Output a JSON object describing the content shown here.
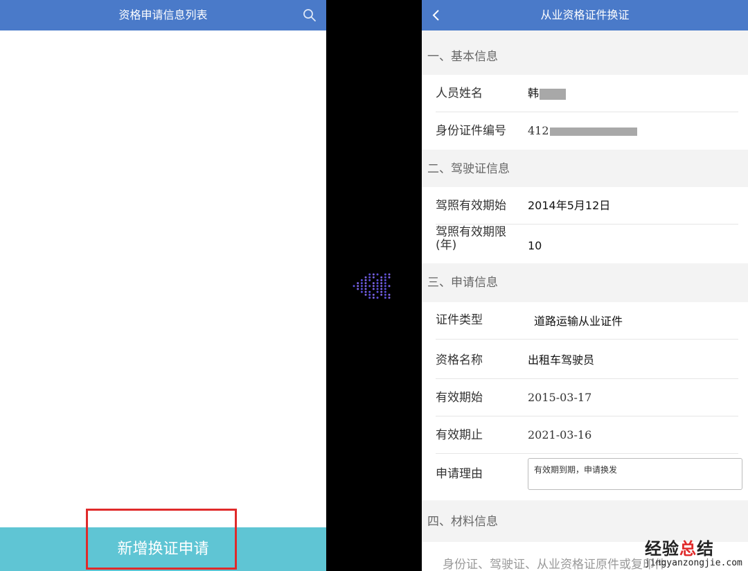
{
  "left_screen": {
    "title": "资格申请信息列表",
    "search_icon": "search-icon",
    "add_button_label": "新增换证申请",
    "header_color": "#4a7ac9",
    "button_color": "#5fc5d4",
    "highlight_color": "#e02a2a"
  },
  "transition_icon": "double-chevron-right-icon",
  "right_screen": {
    "title": "从业资格证件换证",
    "back_icon": "chevron-left-icon",
    "sections": {
      "basic": {
        "header": "一、基本信息",
        "name_label": "人员姓名",
        "name_value": "韩",
        "id_label": "身份证件编号",
        "id_value": "412"
      },
      "license": {
        "header": "二、驾驶证信息",
        "start_label": "驾照有效期始",
        "start_value": "2014年5月12日",
        "limit_label": "驾照有效期限(年)",
        "limit_value": "10"
      },
      "application": {
        "header": "三、申请信息",
        "cert_type_label": "证件类型",
        "cert_type_value": "道路运输从业证件",
        "qual_name_label": "资格名称",
        "qual_name_value": "出租车驾驶员",
        "valid_from_label": "有效期始",
        "valid_from_value": "2015-03-17",
        "valid_to_label": "有效期止",
        "valid_to_value": "2021-03-16",
        "reason_label": "申请理由",
        "reason_value": "有效期到期，申请换发"
      },
      "materials": {
        "header": "四、材料信息",
        "text": "身份证、驾驶证、从业资格证原件或复印件"
      }
    }
  },
  "watermark": {
    "title_part1": "经验",
    "title_part2": "总",
    "title_part3": "结",
    "url": "jingyanzongjie.com"
  }
}
